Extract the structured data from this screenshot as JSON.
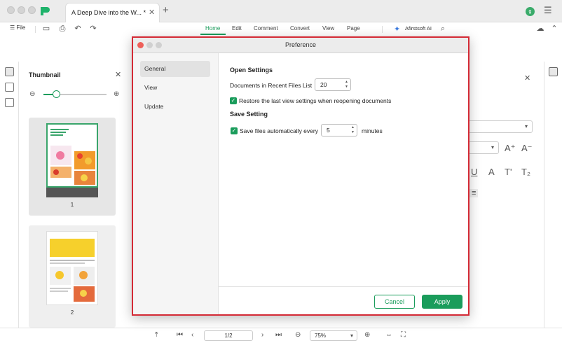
{
  "app": {
    "tab_title": "A Deep Dive into the W...",
    "tab_modified_mark": "*",
    "user_initial": "g"
  },
  "toolbar": {
    "file_label": "File",
    "menus": [
      "Home",
      "Edit",
      "Comment",
      "Convert",
      "View",
      "Page"
    ],
    "ai_label": "Afirstsoft AI"
  },
  "thumbnail_panel": {
    "title": "Thumbnail",
    "zoom_level": 0.2,
    "pages": [
      {
        "number": "1",
        "selected": true
      },
      {
        "number": "2",
        "selected": false
      }
    ]
  },
  "bottom_bar": {
    "page_indicator": "1/2",
    "zoom": "75%"
  },
  "dialog": {
    "title": "Preference",
    "nav": {
      "general": "General",
      "view": "View",
      "update": "Update",
      "selected": "General"
    },
    "open_settings": {
      "title": "Open Settings",
      "recent_files_label": "Documents in Recent Files List",
      "recent_files_value": "20",
      "restore_label": "Restore the last view settings when reopening documents",
      "restore_checked": true
    },
    "save_setting": {
      "title": "Save Setting",
      "autosave_label": "Save files automatically every",
      "autosave_value": "5",
      "autosave_unit": "minutes",
      "autosave_checked": true
    },
    "buttons": {
      "cancel": "Cancel",
      "apply": "Apply"
    }
  },
  "colors": {
    "accent": "#1a9c5b",
    "highlight_border": "#d42a35"
  }
}
